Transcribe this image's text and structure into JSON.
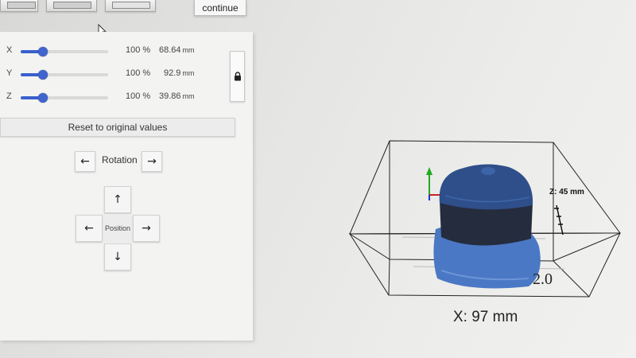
{
  "toolbar": {
    "continue_label": "continue",
    "view_buttons": [
      "view-front",
      "view-side",
      "view-top"
    ]
  },
  "scale": {
    "rows": [
      {
        "axis": "X",
        "percent": "100 %",
        "value": "68.64",
        "unit": "mm",
        "slider_fraction": 0.25
      },
      {
        "axis": "Y",
        "percent": "100 %",
        "value": "92.9",
        "unit": "mm",
        "slider_fraction": 0.25
      },
      {
        "axis": "Z",
        "percent": "100 %",
        "value": "39.86",
        "unit": "mm",
        "slider_fraction": 0.25
      }
    ],
    "lock_icon": "lock-icon",
    "accent_color": "#3a5fcd"
  },
  "reset_label": "Reset to original values",
  "rotation": {
    "label": "Rotation",
    "left_arrow": "←",
    "right_arrow": "→"
  },
  "position": {
    "label": "Position",
    "up": "↑",
    "down": "↓",
    "left": "←",
    "right": "→"
  },
  "viewport": {
    "z_label": "Z: 45 mm",
    "x_label": "X: 97 mm",
    "base_text": "2.0",
    "model_colors": {
      "top": "#2f4f8a",
      "band": "#252c3d",
      "brim": "#4a78c4"
    }
  }
}
